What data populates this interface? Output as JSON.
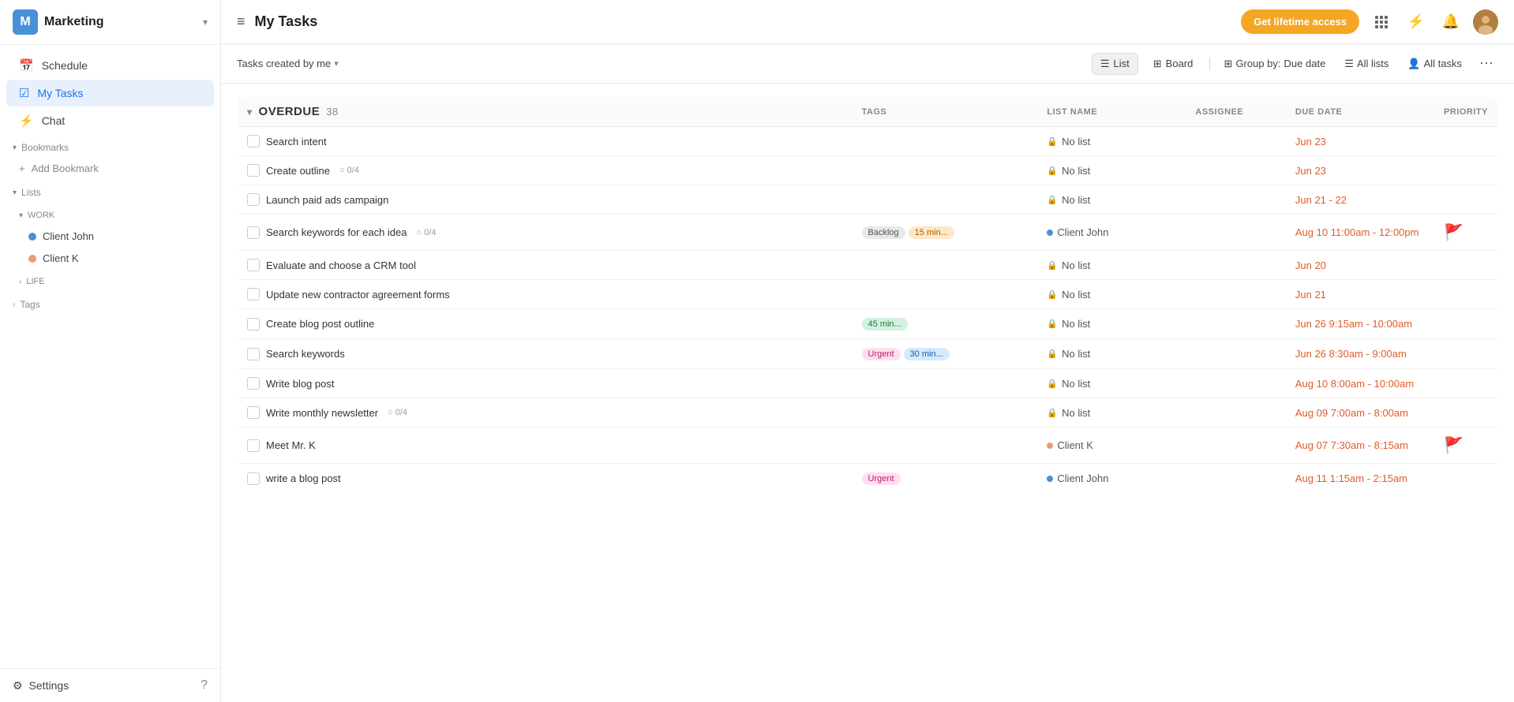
{
  "sidebar": {
    "logo": "M",
    "workspace": "Marketing",
    "chevron": "▾",
    "nav_items": [
      {
        "id": "schedule",
        "label": "Schedule",
        "icon": "📅"
      },
      {
        "id": "my-tasks",
        "label": "My Tasks",
        "icon": "✓",
        "active": true
      },
      {
        "id": "chat",
        "label": "Chat",
        "icon": "⚡"
      }
    ],
    "bookmarks_header": "Bookmarks",
    "add_bookmark": "Add Bookmark",
    "lists_header": "Lists",
    "work_header": "WORK",
    "life_header": "LIFE",
    "lists": [
      {
        "id": "client-john",
        "label": "Client John",
        "color": "blue"
      },
      {
        "id": "client-k",
        "label": "Client K",
        "color": "pink"
      }
    ],
    "tags_header": "Tags",
    "settings_label": "Settings"
  },
  "header": {
    "hamburger": "≡",
    "title": "My Tasks",
    "btn_lifetime": "Get lifetime access",
    "apps_icon": "⋮⋮⋮",
    "bolt_icon": "⚡",
    "bell_icon": "🔔",
    "avatar_text": ""
  },
  "toolbar": {
    "filter_label": "Tasks created by me",
    "filter_chevron": "▾",
    "list_label": "List",
    "board_label": "Board",
    "group_by_label": "Group by:",
    "group_by_value": "Due date",
    "all_lists_label": "All lists",
    "all_tasks_label": "All tasks",
    "more_icon": "⋯"
  },
  "tasks": {
    "section_title": "Overdue",
    "section_count": "38",
    "section_chevron": "▾",
    "columns": {
      "tags": "TAGS",
      "list_name": "LIST NAME",
      "assignee": "ASSIGNEE",
      "due_date": "DUE DATE",
      "priority": "PRIORITY"
    },
    "rows": [
      {
        "id": 1,
        "name": "Search intent",
        "subtask": null,
        "tags": [],
        "list_name": "No list",
        "list_type": "lock",
        "assignee": "",
        "due_date": "Jun 23",
        "priority_flag": null
      },
      {
        "id": 2,
        "name": "Create outline",
        "subtask": "0/4",
        "tags": [],
        "list_name": "No list",
        "list_type": "lock",
        "assignee": "",
        "due_date": "Jun 23",
        "priority_flag": null
      },
      {
        "id": 3,
        "name": "Launch paid ads campaign",
        "subtask": null,
        "tags": [],
        "list_name": "No list",
        "list_type": "lock",
        "assignee": "",
        "due_date": "Jun 21 - 22",
        "priority_flag": null
      },
      {
        "id": 4,
        "name": "Search keywords for each idea",
        "subtask": "0/4",
        "tags": [
          {
            "label": "Backlog",
            "class": "tag-backlog"
          },
          {
            "label": "15 min...",
            "class": "tag-15min"
          }
        ],
        "list_name": "Client John",
        "list_type": "blue-dot",
        "assignee": "",
        "due_date": "Aug 10 11:00am - 12:00pm",
        "priority_flag": "orange"
      },
      {
        "id": 5,
        "name": "Evaluate and choose a CRM tool",
        "subtask": null,
        "tags": [],
        "list_name": "No list",
        "list_type": "lock",
        "assignee": "",
        "due_date": "Jun 20",
        "priority_flag": null
      },
      {
        "id": 6,
        "name": "Update new contractor agreement forms",
        "subtask": null,
        "tags": [],
        "list_name": "No list",
        "list_type": "lock",
        "assignee": "",
        "due_date": "Jun 21",
        "priority_flag": null
      },
      {
        "id": 7,
        "name": "Create blog post outline",
        "subtask": null,
        "tags": [
          {
            "label": "45 min...",
            "class": "tag-45min"
          }
        ],
        "list_name": "No list",
        "list_type": "lock",
        "assignee": "",
        "due_date": "Jun 26 9:15am - 10:00am",
        "priority_flag": null
      },
      {
        "id": 8,
        "name": "Search keywords",
        "subtask": null,
        "tags": [
          {
            "label": "Urgent",
            "class": "tag-urgent"
          },
          {
            "label": "30 min...",
            "class": "tag-30min"
          }
        ],
        "list_name": "No list",
        "list_type": "lock",
        "assignee": "",
        "due_date": "Jun 26 8:30am - 9:00am",
        "priority_flag": null
      },
      {
        "id": 9,
        "name": "Write blog post",
        "subtask": null,
        "tags": [],
        "list_name": "No list",
        "list_type": "lock",
        "assignee": "",
        "due_date": "Aug 10 8:00am - 10:00am",
        "priority_flag": null
      },
      {
        "id": 10,
        "name": "Write monthly newsletter",
        "subtask": "0/4",
        "tags": [],
        "list_name": "No list",
        "list_type": "lock",
        "assignee": "",
        "due_date": "Aug 09 7:00am - 8:00am",
        "priority_flag": null
      },
      {
        "id": 11,
        "name": "Meet Mr. K",
        "subtask": null,
        "tags": [],
        "list_name": "Client K",
        "list_type": "pink-dot",
        "assignee": "",
        "due_date": "Aug 07 7:30am - 8:15am",
        "priority_flag": "red"
      },
      {
        "id": 12,
        "name": "write a blog post",
        "subtask": null,
        "tags": [
          {
            "label": "Urgent",
            "class": "tag-urgent"
          }
        ],
        "list_name": "Client John",
        "list_type": "blue-dot",
        "assignee": "",
        "due_date": "Aug 11 1:15am - 2:15am",
        "priority_flag": null
      }
    ]
  },
  "colors": {
    "accent_blue": "#1a73e8",
    "accent_orange": "#f5a623",
    "sidebar_bg": "#ffffff",
    "active_bg": "#e8f0fe",
    "overdue_red": "#e05c2a"
  }
}
